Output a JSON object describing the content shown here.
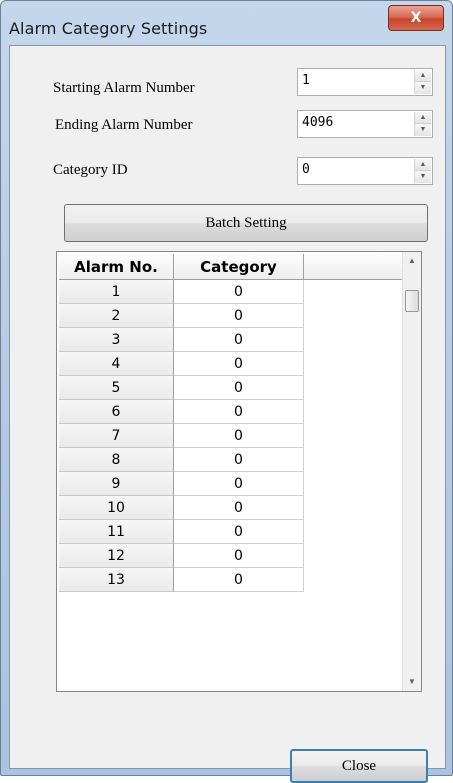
{
  "window": {
    "title": "Alarm Category Settings",
    "close_glyph": "X"
  },
  "fields": {
    "start_label": "Starting Alarm Number",
    "start_value": "1",
    "end_label": "Ending Alarm Number",
    "end_value": "4096",
    "category_label": "Category ID",
    "category_value": "0",
    "spin_up": "▲",
    "spin_down": "▼"
  },
  "buttons": {
    "batch_label": "Batch Setting",
    "close_label": "Close"
  },
  "grid": {
    "columns": [
      "Alarm No.",
      "Category"
    ],
    "rows": [
      {
        "no": "1",
        "category": "0"
      },
      {
        "no": "2",
        "category": "0"
      },
      {
        "no": "3",
        "category": "0"
      },
      {
        "no": "4",
        "category": "0"
      },
      {
        "no": "5",
        "category": "0"
      },
      {
        "no": "6",
        "category": "0"
      },
      {
        "no": "7",
        "category": "0"
      },
      {
        "no": "8",
        "category": "0"
      },
      {
        "no": "9",
        "category": "0"
      },
      {
        "no": "10",
        "category": "0"
      },
      {
        "no": "11",
        "category": "0"
      },
      {
        "no": "12",
        "category": "0"
      },
      {
        "no": "13",
        "category": "0"
      }
    ],
    "scroll_up": "▲",
    "scroll_down": "▼"
  }
}
